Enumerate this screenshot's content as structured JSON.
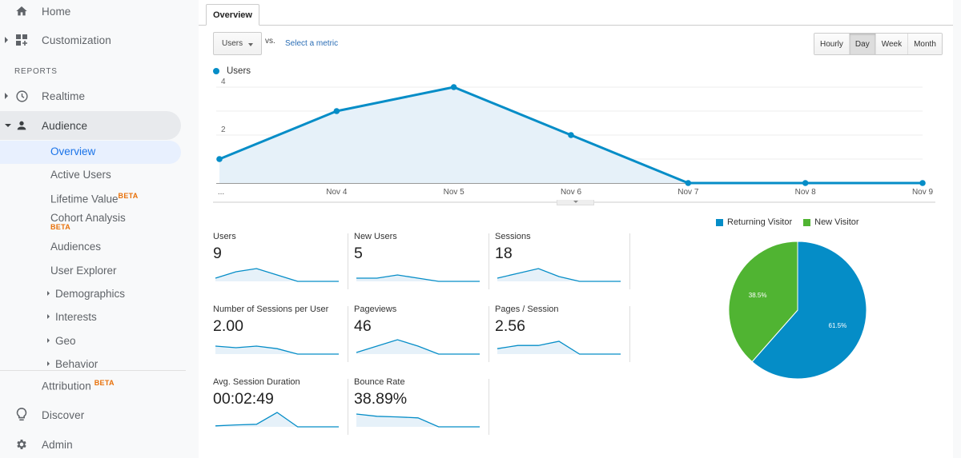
{
  "sidebar": {
    "home": "Home",
    "customization": "Customization",
    "reports_header": "REPORTS",
    "realtime": "Realtime",
    "audience": "Audience",
    "audience_items": {
      "overview": "Overview",
      "active_users": "Active Users",
      "lifetime_value": "Lifetime Value",
      "cohort_analysis": "Cohort Analysis",
      "audiences": "Audiences",
      "user_explorer": "User Explorer",
      "demographics": "Demographics",
      "interests": "Interests",
      "geo": "Geo",
      "behavior": "Behavior"
    },
    "beta_badge": "BETA",
    "attribution": "Attribution",
    "discover": "Discover",
    "admin": "Admin"
  },
  "main": {
    "tab": "Overview",
    "metric_select": "Users",
    "vs_label": "vs.",
    "select_metric": "Select a metric",
    "time_buttons": [
      "Hourly",
      "Day",
      "Week",
      "Month"
    ],
    "active_time_button": "Day",
    "legend": "Users"
  },
  "chart_data": [
    {
      "type": "area",
      "title": "",
      "series": [
        {
          "name": "Users",
          "color": "#058dc7",
          "values": [
            1,
            3,
            4,
            2,
            0,
            0,
            0
          ]
        }
      ],
      "x": [
        "...",
        "Nov 4",
        "Nov 5",
        "Nov 6",
        "Nov 7",
        "Nov 8",
        "Nov 9"
      ],
      "y_ticks": [
        "2",
        "4"
      ],
      "ylim": [
        0,
        4.2
      ],
      "grid": true
    },
    {
      "type": "pie",
      "slices": [
        {
          "label": "Returning Visitor",
          "value": 61.5,
          "text": "61.5%",
          "color": "#058dc7"
        },
        {
          "label": "New Visitor",
          "value": 38.5,
          "text": "38.5%",
          "color": "#50b432"
        }
      ],
      "legend": "top"
    }
  ],
  "metrics": [
    {
      "name": "Users",
      "value": "9",
      "spark": [
        1,
        3,
        4,
        2,
        0,
        0,
        0
      ]
    },
    {
      "name": "New Users",
      "value": "5",
      "spark": [
        1,
        1,
        2,
        1,
        0,
        0,
        0
      ]
    },
    {
      "name": "Sessions",
      "value": "18",
      "spark": [
        1,
        2.5,
        4,
        1.5,
        0,
        0,
        0
      ]
    },
    {
      "name": "Number of Sessions per User",
      "value": "2.00",
      "spark": [
        2.5,
        2,
        2.5,
        1.7,
        0,
        0,
        0
      ]
    },
    {
      "name": "Pageviews",
      "value": "46",
      "spark": [
        0.5,
        2.5,
        4.5,
        2.5,
        0,
        0,
        0
      ]
    },
    {
      "name": "Pages / Session",
      "value": "2.56",
      "spark": [
        1.7,
        2.7,
        2.7,
        4,
        0,
        0,
        0
      ]
    },
    {
      "name": "Avg. Session Duration",
      "value": "00:02:49",
      "spark": [
        0.3,
        0.6,
        0.8,
        4.5,
        0,
        0,
        0
      ]
    },
    {
      "name": "Bounce Rate",
      "value": "38.89%",
      "spark": [
        4,
        3.3,
        3.1,
        2.8,
        0,
        0,
        0
      ]
    }
  ]
}
